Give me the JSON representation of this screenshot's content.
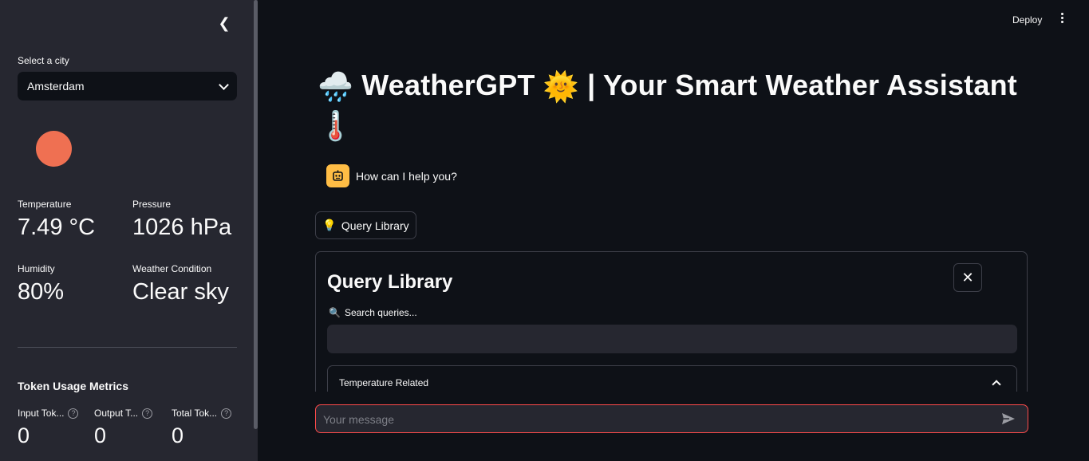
{
  "sidebar": {
    "city_label": "Select a city",
    "city_value": "Amsterdam",
    "metrics": [
      {
        "label": "Temperature",
        "value": "7.49 °C"
      },
      {
        "label": "Pressure",
        "value": "1026 hPa"
      },
      {
        "label": "Humidity",
        "value": "80%"
      },
      {
        "label": "Weather Condition",
        "value": "Clear sky"
      }
    ],
    "token_title": "Token Usage Metrics",
    "tokens": [
      {
        "label": "Input Tok...",
        "value": "0"
      },
      {
        "label": "Output T...",
        "value": "0"
      },
      {
        "label": "Total Tok...",
        "value": "0"
      }
    ],
    "weather_color": "#ef7052"
  },
  "header": {
    "deploy_label": "Deploy"
  },
  "main": {
    "title_icon_left": "🌧️",
    "title_text": "WeatherGPT",
    "title_icon_mid": "🌞",
    "title_suffix": "| Your Smart Weather Assistant",
    "title_icon_end": "🌡️",
    "assistant_message": "How can I help you?",
    "query_library_button": "Query Library",
    "query_library_button_icon": "💡",
    "panel": {
      "title": "Query Library",
      "search_label": "Search queries...",
      "search_icon": "🔍",
      "search_value": "",
      "expander_label": "Temperature Related"
    },
    "chat_placeholder": "Your message"
  },
  "colors": {
    "background": "#0e1117",
    "sidebar": "#262730",
    "accent": "#ff4b4b",
    "avatar": "#ffbd45"
  }
}
